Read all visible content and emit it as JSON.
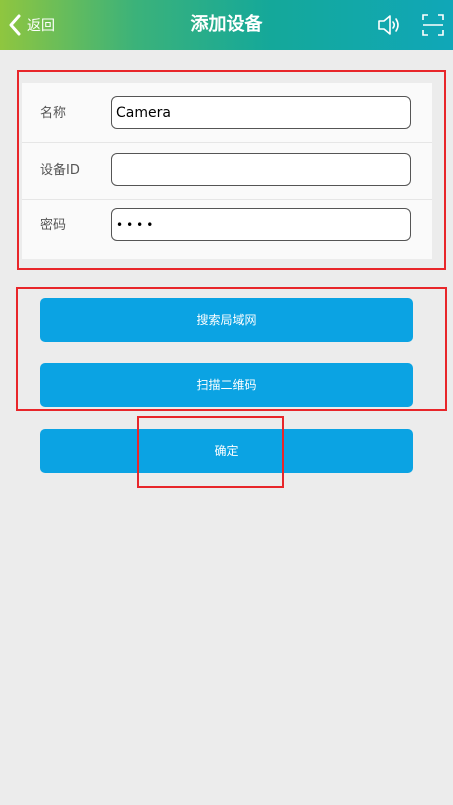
{
  "header": {
    "back_label": "返回",
    "title": "添加设备",
    "icons": [
      "chevron-left-icon",
      "speaker-icon",
      "fullscreen-icon"
    ]
  },
  "form": {
    "name_label": "名称",
    "name_value": "Camera",
    "device_id_label": "设备ID",
    "device_id_value": "",
    "password_label": "密码",
    "password_masked": "••••"
  },
  "buttons": {
    "search_lan": "搜索局域网",
    "scan_qr": "扫描二维码",
    "confirm": "确定"
  },
  "colors": {
    "primary_button": "#0ba3e3",
    "highlight_box": "#e8262a",
    "background": "#ececec"
  }
}
